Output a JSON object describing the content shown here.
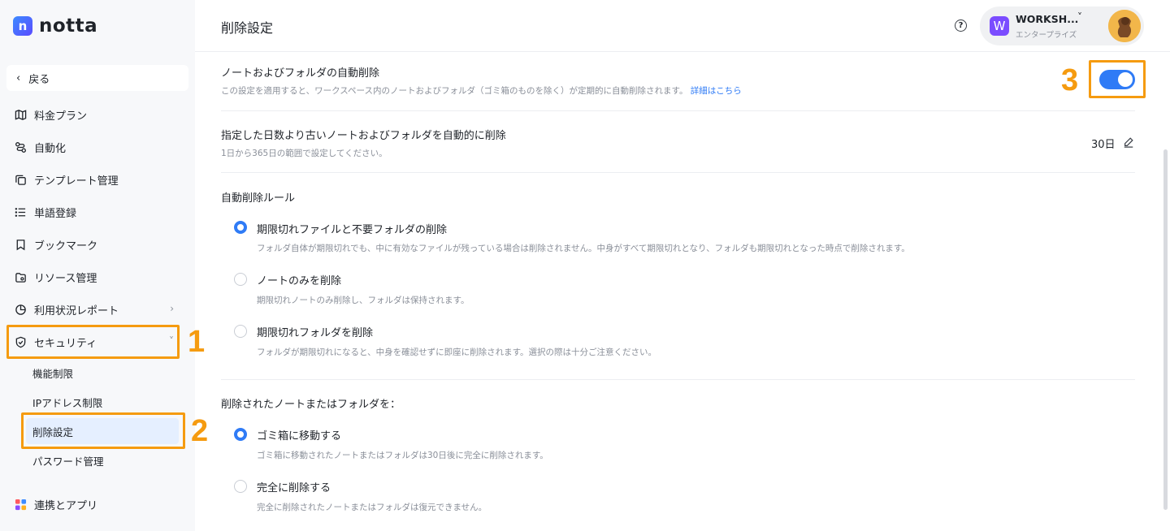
{
  "app": {
    "logo_letter": "n",
    "logo_text": "notta"
  },
  "sidebar": {
    "back_label": "戻る",
    "items": [
      {
        "label": "料金プラン",
        "icon": "map-icon"
      },
      {
        "label": "自動化",
        "icon": "automation-icon"
      },
      {
        "label": "テンプレート管理",
        "icon": "template-icon"
      },
      {
        "label": "単語登録",
        "icon": "list-icon"
      },
      {
        "label": "ブックマーク",
        "icon": "bookmark-icon"
      },
      {
        "label": "リソース管理",
        "icon": "resource-icon"
      },
      {
        "label": "利用状況レポート",
        "icon": "report-icon"
      },
      {
        "label": "セキュリティ",
        "icon": "shield-icon"
      }
    ],
    "security_sub": [
      "機能制限",
      "IPアドレス制限",
      "削除設定",
      "パスワード管理"
    ],
    "integrations_label": "連携とアプリ"
  },
  "annotations": [
    "1",
    "2",
    "3"
  ],
  "header": {
    "title": "削除設定",
    "help": "?",
    "workspace_badge": "W",
    "workspace_name": "WORKSH...",
    "workspace_plan": "エンタープライズ"
  },
  "auto_delete": {
    "title": "ノートおよびフォルダの自動削除",
    "desc": "この設定を適用すると、ワークスペース内のノートおよびフォルダ（ゴミ箱のものを除く）が定期的に自動削除されます。",
    "link": "詳細はこちら",
    "enabled": true
  },
  "older_than": {
    "title": "指定した日数より古いノートおよびフォルダを自動的に削除",
    "desc": "1日から365日の範囲で設定してください。",
    "value": "30日"
  },
  "rules": {
    "title": "自動削除ルール",
    "options": [
      {
        "label": "期限切れファイルと不要フォルダの削除",
        "desc": "フォルダ自体が期限切れでも、中に有効なファイルが残っている場合は削除されません。中身がすべて期限切れとなり、フォルダも期限切れとなった時点で削除されます。",
        "selected": true
      },
      {
        "label": "ノートのみを削除",
        "desc": "期限切れノートのみ削除し、フォルダは保持されます。",
        "selected": false
      },
      {
        "label": "期限切れフォルダを削除",
        "desc": "フォルダが期限切れになると、中身を確認せずに即座に削除されます。選択の際は十分ご注意ください。",
        "selected": false
      }
    ]
  },
  "deleted_action": {
    "title": "削除されたノートまたはフォルダを：",
    "options": [
      {
        "label": "ゴミ箱に移動する",
        "desc": "ゴミ箱に移動されたノートまたはフォルダは30日後に完全に削除されます。",
        "selected": true
      },
      {
        "label": "完全に削除する",
        "desc": "完全に削除されたノートまたはフォルダは復元できません。",
        "selected": false
      }
    ]
  },
  "colors": {
    "accent": "#2f7bf6",
    "highlight": "#f59b10"
  }
}
